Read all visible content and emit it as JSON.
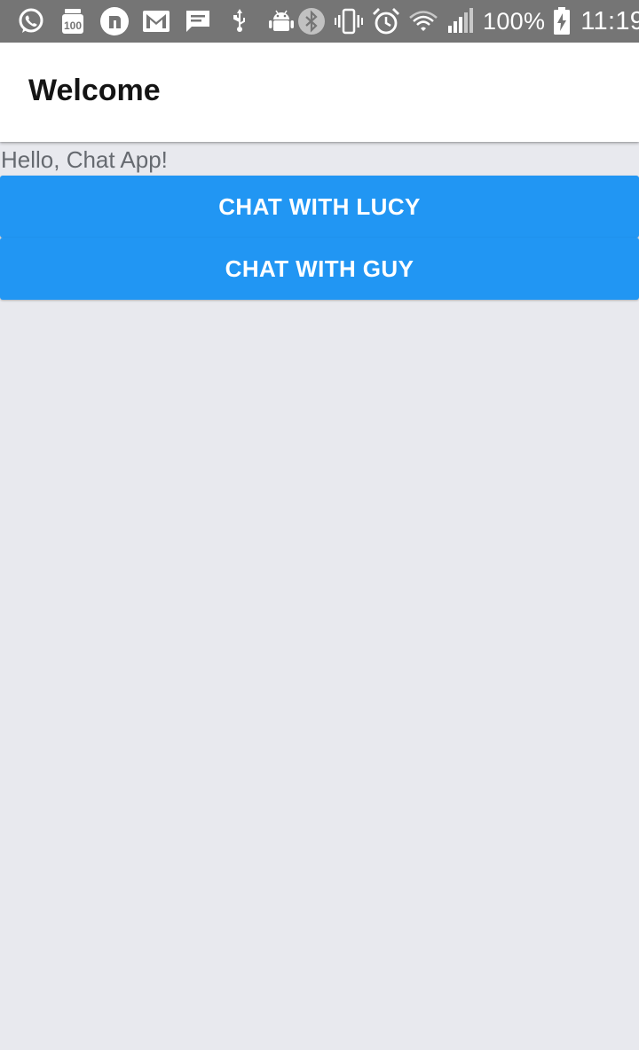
{
  "status_bar": {
    "left_icons": [
      "whatsapp-icon",
      "badge-100-icon",
      "circle-app-icon",
      "gmail-icon",
      "message-icon",
      "usb-icon",
      "android-debug-icon"
    ],
    "right_icons": [
      "bluetooth-icon",
      "vibrate-icon",
      "alarm-icon",
      "wifi-icon",
      "cell-signal-icon",
      "battery-charging-icon"
    ],
    "battery": "100%",
    "time": "11:19",
    "background_color": "#757575"
  },
  "app_bar": {
    "title": "Welcome"
  },
  "main": {
    "greeting": "Hello, Chat App!",
    "buttons": [
      {
        "label": "CHAT WITH LUCY"
      },
      {
        "label": "CHAT WITH GUY"
      }
    ]
  },
  "colors": {
    "accent": "#2196f3",
    "background": "#e8e9ee",
    "title_text": "#141414",
    "greeting_text": "#666a70"
  }
}
